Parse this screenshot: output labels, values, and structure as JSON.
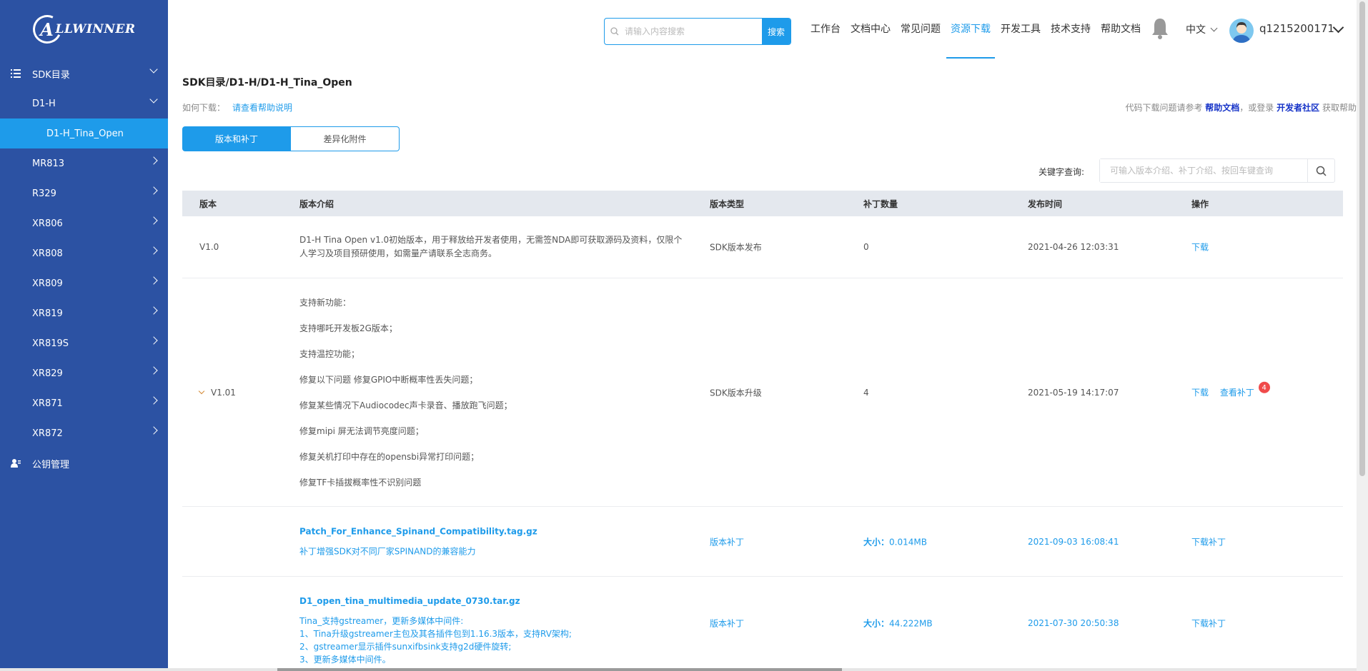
{
  "brand": {
    "logo_text": "LLWINNER",
    "logo_letter": "A"
  },
  "sidebar": {
    "items": [
      {
        "label": "SDK目录",
        "level": 1,
        "state": "expanded",
        "icon": "list-icon"
      },
      {
        "label": "D1-H",
        "level": 2,
        "state": "expanded"
      },
      {
        "label": "D1-H_Tina_Open",
        "level": 3,
        "state": "selected"
      },
      {
        "label": "MR813",
        "level": 2,
        "state": "collapsed"
      },
      {
        "label": "R329",
        "level": 2,
        "state": "collapsed"
      },
      {
        "label": "XR806",
        "level": 2,
        "state": "collapsed"
      },
      {
        "label": "XR808",
        "level": 2,
        "state": "collapsed"
      },
      {
        "label": "XR809",
        "level": 2,
        "state": "collapsed"
      },
      {
        "label": "XR819",
        "level": 2,
        "state": "collapsed"
      },
      {
        "label": "XR819S",
        "level": 2,
        "state": "collapsed"
      },
      {
        "label": "XR829",
        "level": 2,
        "state": "collapsed"
      },
      {
        "label": "XR871",
        "level": 2,
        "state": "collapsed"
      },
      {
        "label": "XR872",
        "level": 2,
        "state": "collapsed"
      },
      {
        "label": "公钥管理",
        "level": 1,
        "state": "none",
        "icon": "user-key-icon"
      }
    ]
  },
  "header": {
    "search_placeholder": "请输入内容搜索",
    "search_button": "搜索",
    "nav": [
      "工作台",
      "文档中心",
      "常见问题",
      "资源下载",
      "开发工具",
      "技术支持",
      "帮助文档"
    ],
    "active_nav": "资源下载",
    "language": "中文",
    "username": "q1215200171"
  },
  "main": {
    "breadcrumb": "SDK目录/D1-H/D1-H_Tina_Open",
    "howto_label": "如何下载：",
    "howto_link": "请查看帮助说明",
    "help_prefix": "代码下载问题请参考",
    "help_doc": "帮助文档",
    "help_mid": "，或登录",
    "help_community": "开发者社区",
    "help_suffix": "获取帮助",
    "tabs": [
      "版本和补丁",
      "差异化附件"
    ],
    "keyword_label": "关键字查询:",
    "keyword_placeholder": "可输入版本介绍、补丁介绍、按回车键查询",
    "columns": [
      "版本",
      "版本介绍",
      "版本类型",
      "补丁数量",
      "发布时间",
      "操作"
    ],
    "rows": [
      {
        "version": "V1.0",
        "intro": "D1-H Tina Open v1.0初始版本，用于释放给开发者使用，无需签NDA即可获取源码及资料，仅限个人学习及项目预研使用，如需量产请联系全志商务。",
        "type": "SDK版本发布",
        "patches": "0",
        "date": "2021-04-26 12:03:31",
        "action": "下载"
      },
      {
        "version": "V1.01",
        "features": [
          "支持新功能：",
          "支持哪吒开发板2G版本；",
          "支持温控功能；",
          "修复以下问题 修复GPIO中断概率性丢失问题；",
          "修复某些情况下Audiocodec声卡录音、播放跑飞问题；",
          "修复mipi 屏无法调节亮度问题；",
          "修复关机打印中存在的opensbi异常打印问题；",
          "修复TF卡插拔概率性不识别问题"
        ],
        "type": "SDK版本升级",
        "patches": "4",
        "date": "2021-05-19 14:17:07",
        "action": "下载",
        "action2": "查看补丁",
        "badge": "4"
      }
    ],
    "patches": [
      {
        "name": "Patch_For_Enhance_Spinand_Compatibility.tag.gz",
        "desc": "补丁增强SDK对不同厂家SPINAND的兼容能力",
        "type": "版本补丁",
        "size_label": "大小：",
        "size": "0.014MB",
        "date": "2021-09-03 16:08:41",
        "action": "下载补丁"
      },
      {
        "name": "D1_open_tina_multimedia_update_0730.tar.gz",
        "desc_lines": [
          "Tina_支持gstreamer，更新多媒体中间件:",
          "1、Tina升级gstreamer主包及其各插件包到1.16.3版本，支持RV架构;",
          "2、gstreamer显示插件sunxifbsink支持g2d硬件旋转;",
          "3、更新多媒体中间件。"
        ],
        "type": "版本补丁",
        "size_label": "大小：",
        "size": "44.222MB",
        "date": "2021-07-30 20:50:38",
        "action": "下载补丁"
      }
    ]
  },
  "colors": {
    "sidebar": "#2c52a3",
    "accent": "#1e9bea",
    "selected_item": "#1e9bea",
    "badge": "#f04a4a"
  }
}
